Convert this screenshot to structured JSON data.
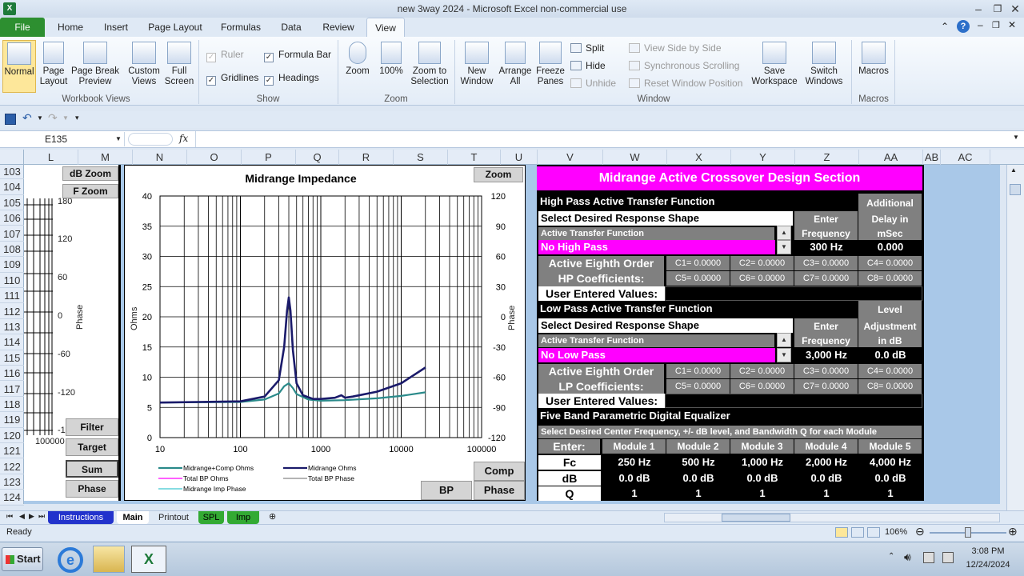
{
  "window": {
    "title": "new 3way 2024  -  Microsoft Excel non-commercial use"
  },
  "tabs": {
    "file": "File",
    "home": "Home",
    "insert": "Insert",
    "page_layout": "Page Layout",
    "formulas": "Formulas",
    "data": "Data",
    "review": "Review",
    "view": "View"
  },
  "ribbon": {
    "workbook_views": {
      "normal": "Normal",
      "page_layout": "Page Layout",
      "page_break": "Page Break Preview",
      "custom_views": "Custom Views",
      "full_screen": "Full Screen",
      "group": "Workbook Views"
    },
    "show": {
      "ruler": "Ruler",
      "formula_bar": "Formula Bar",
      "gridlines": "Gridlines",
      "headings": "Headings",
      "group": "Show"
    },
    "zoom": {
      "zoom": "Zoom",
      "hundred": "100%",
      "zoom_selection": "Zoom to Selection",
      "group": "Zoom"
    },
    "window": {
      "new_window": "New Window",
      "arrange_all": "Arrange All",
      "freeze_panes": "Freeze Panes",
      "split": "Split",
      "hide": "Hide",
      "unhide": "Unhide",
      "view_side": "View Side by Side",
      "sync_scroll": "Synchronous Scrolling",
      "reset_pos": "Reset Window Position",
      "save_ws": "Save Workspace",
      "switch_win": "Switch Windows",
      "group": "Window"
    },
    "macros": {
      "macros": "Macros",
      "group": "Macros"
    }
  },
  "formula_bar": {
    "name_box": "E135",
    "fx": "fx",
    "value": ""
  },
  "columns": [
    "L",
    "M",
    "N",
    "O",
    "P",
    "Q",
    "R",
    "S",
    "T",
    "U",
    "V",
    "W",
    "X",
    "Y",
    "Z",
    "AA",
    "AB",
    "AC"
  ],
  "rows": [
    "103",
    "104",
    "105",
    "106",
    "107",
    "108",
    "109",
    "110",
    "111",
    "112",
    "113",
    "114",
    "115",
    "116",
    "117",
    "118",
    "119",
    "120",
    "121",
    "122",
    "123",
    "124"
  ],
  "left_panel": {
    "db_zoom": "dB Zoom",
    "f_zoom": "F Zoom",
    "filter": "Filter",
    "target": "Target",
    "sum": "Sum",
    "phase": "Phase",
    "phase_label": "Phase",
    "ticks": [
      "180",
      "120",
      "60",
      "0",
      "-60",
      "-120",
      "-1"
    ],
    "bottom_tick": "100000"
  },
  "chart_data": {
    "type": "line",
    "title": "Midrange Impedance",
    "ylabel": "Ohms",
    "y2label": "Phase",
    "x_scale": "log",
    "xlim": [
      10,
      100000
    ],
    "ylim": [
      0,
      40
    ],
    "y2lim": [
      -120,
      120
    ],
    "x_ticks": [
      "10",
      "100",
      "1000",
      "10000",
      "100000"
    ],
    "y_ticks": [
      "0",
      "5",
      "10",
      "15",
      "20",
      "25",
      "30",
      "35",
      "40"
    ],
    "y2_ticks": [
      "-120",
      "-90",
      "-60",
      "-30",
      "0",
      "30",
      "60",
      "90",
      "120"
    ],
    "series": [
      {
        "name": "Midrange+Comp Ohms",
        "color": "#2a8a8a",
        "x": [
          10,
          100,
          200,
          300,
          350,
          400,
          450,
          500,
          700,
          1000,
          2000,
          5000,
          10000,
          20000
        ],
        "y": [
          5.8,
          5.9,
          6.3,
          7.3,
          8.5,
          9.0,
          8.2,
          7.2,
          6.3,
          6.1,
          6.2,
          6.5,
          6.9,
          7.5
        ]
      },
      {
        "name": "Midrange Ohms",
        "color": "#1a1a6a",
        "x": [
          10,
          100,
          200,
          300,
          350,
          380,
          400,
          420,
          450,
          500,
          600,
          800,
          1000,
          1500,
          1800,
          2000,
          2500,
          5000,
          10000,
          20000
        ],
        "y": [
          5.8,
          6.0,
          6.8,
          9.5,
          15.0,
          21.0,
          23.2,
          21.0,
          14.5,
          9.0,
          7.0,
          6.4,
          6.4,
          6.6,
          7.0,
          6.6,
          6.8,
          7.6,
          9.0,
          11.6
        ]
      },
      {
        "name": "Total BP Ohms",
        "color": "#ff00ff",
        "x": [],
        "y": []
      },
      {
        "name": "Total BP Phase",
        "color": "#888888",
        "x": [],
        "y": []
      },
      {
        "name": "Midrange Imp Phase",
        "color": "#3fc8d0",
        "x": [],
        "y": []
      }
    ],
    "buttons": {
      "zoom": "Zoom",
      "comp": "Comp",
      "phase": "Phase",
      "bp": "BP"
    }
  },
  "crossover": {
    "title": "Midrange Active Crossover Design Section",
    "hp": {
      "heading": "High Pass Active Transfer Function",
      "additional": "Additional",
      "select": "Select Desired Response Shape",
      "enter": "Enter",
      "delay_in": "Delay in",
      "atf": "Active Transfer Function",
      "frequency": "Frequency",
      "msec": "mSec",
      "shape": "No High Pass",
      "freq": "300 Hz",
      "delay": "0.000",
      "coeff1": "Active Eighth Order",
      "coeff2": "HP  Coefficients:",
      "c": [
        "C1= 0.0000",
        "C2= 0.0000",
        "C3= 0.0000",
        "C4= 0.0000",
        "C5= 0.0000",
        "C6= 0.0000",
        "C7= 0.0000",
        "C8= 0.0000"
      ],
      "user": "User Entered Values:"
    },
    "lp": {
      "heading": "Low Pass Active Transfer Function",
      "level": "Level",
      "select": "Select Desired Response Shape",
      "enter": "Enter",
      "adjust": "Adjustment",
      "atf": "Active Transfer Function",
      "frequency": "Frequency",
      "indb": "in dB",
      "shape": "No Low Pass",
      "freq": "3,000 Hz",
      "level_val": "0.0 dB",
      "coeff1": "Active Eighth Order",
      "coeff2": "LP  Coefficients:",
      "c": [
        "C1= 0.0000",
        "C2= 0.0000",
        "C3= 0.0000",
        "C4= 0.0000",
        "C5= 0.0000",
        "C6= 0.0000",
        "C7= 0.0000",
        "C8= 0.0000"
      ],
      "user": "User Entered Values:"
    },
    "eq": {
      "heading": "Five Band Parametric Digital Equalizer",
      "sub": "Select Desired Center Frequency, +/- dB level, and Bandwidth Q for each Module",
      "enter": "Enter:",
      "modules": [
        "Module 1",
        "Module 2",
        "Module 3",
        "Module 4",
        "Module 5"
      ],
      "fc_label": "Fc",
      "db_label": "dB",
      "q_label": "Q",
      "fc": [
        "250 Hz",
        "500 Hz",
        "1,000 Hz",
        "2,000 Hz",
        "4,000 Hz"
      ],
      "db": [
        "0.0 dB",
        "0.0 dB",
        "0.0 dB",
        "0.0 dB",
        "0.0 dB"
      ],
      "q": [
        "1",
        "1",
        "1",
        "1",
        "1"
      ]
    }
  },
  "sheet_tabs": [
    {
      "label": "Instructions",
      "color": "#2233cc",
      "text": "#ffffff"
    },
    {
      "label": "Main",
      "color": "#ffffff",
      "text": "#000000"
    },
    {
      "label": "Printout",
      "color": "#dfe9f5",
      "text": "#222222"
    },
    {
      "label": "SPL",
      "color": "#33aa33",
      "text": "#000000"
    },
    {
      "label": "Imp",
      "color": "#33aa33",
      "text": "#000000"
    }
  ],
  "status": {
    "ready": "Ready",
    "zoom": "106%"
  },
  "taskbar": {
    "start": "Start",
    "time": "3:08 PM",
    "date": "12/24/2024"
  }
}
